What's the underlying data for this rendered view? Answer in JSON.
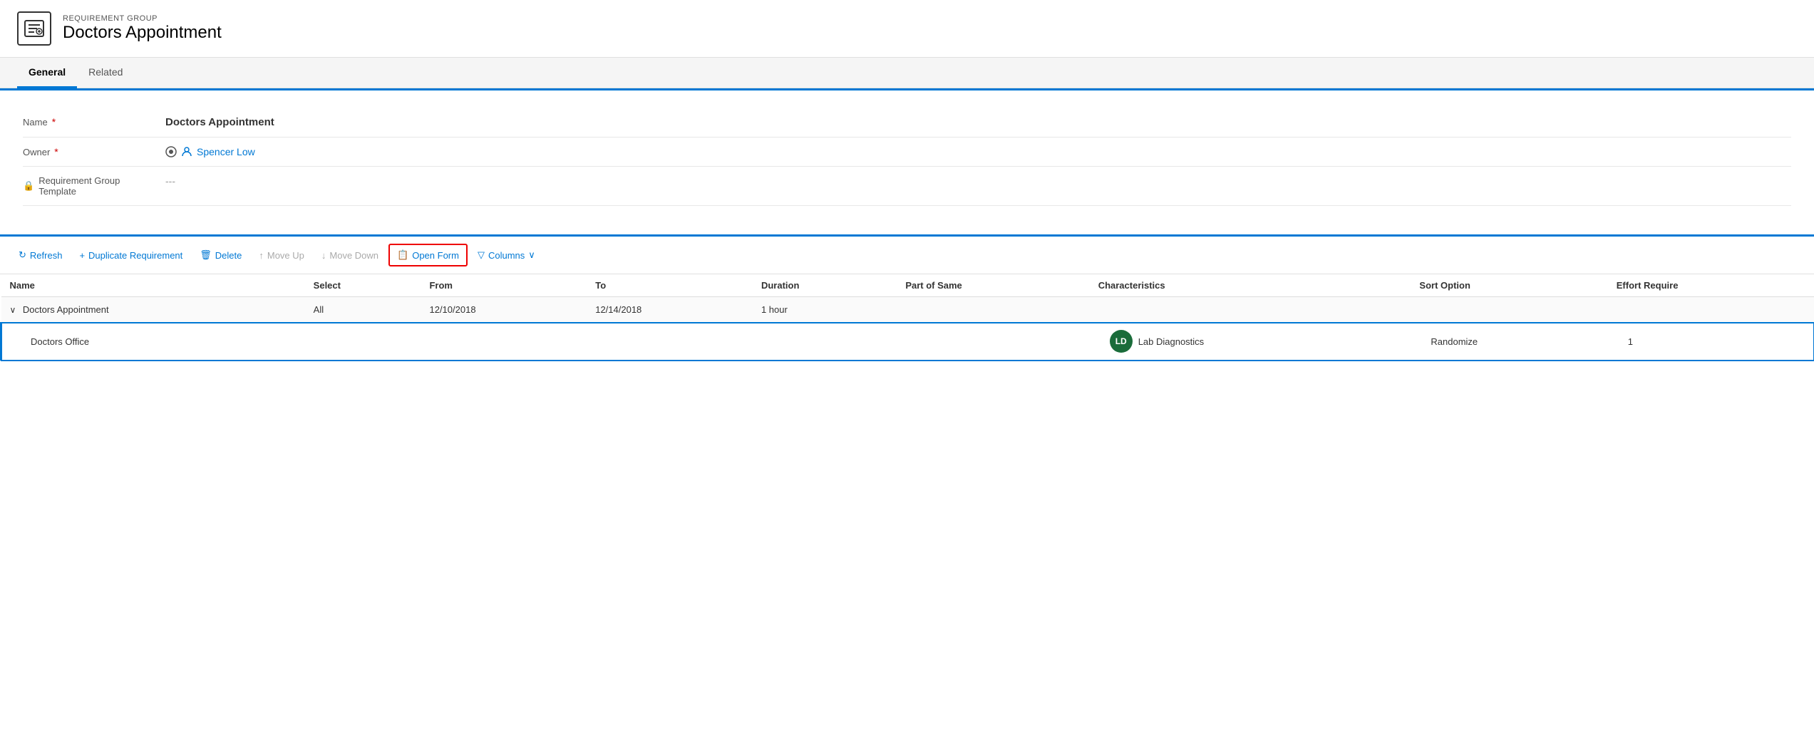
{
  "header": {
    "subtitle": "REQUIREMENT GROUP",
    "title": "Doctors Appointment"
  },
  "tabs": [
    {
      "label": "General",
      "active": true
    },
    {
      "label": "Related",
      "active": false
    }
  ],
  "form": {
    "fields": [
      {
        "label": "Name",
        "required": true,
        "value": "Doctors Appointment",
        "type": "bold"
      },
      {
        "label": "Owner",
        "required": true,
        "value": "Spencer Low",
        "type": "link"
      },
      {
        "label": "Requirement Group Template",
        "required": false,
        "value": "---",
        "type": "placeholder",
        "locked": true
      }
    ]
  },
  "toolbar": {
    "refresh_label": "Refresh",
    "duplicate_label": "Duplicate Requirement",
    "delete_label": "Delete",
    "move_up_label": "Move Up",
    "move_down_label": "Move Down",
    "open_form_label": "Open Form",
    "columns_label": "Columns"
  },
  "grid": {
    "columns": [
      {
        "label": "Name"
      },
      {
        "label": "Select"
      },
      {
        "label": "From"
      },
      {
        "label": "To"
      },
      {
        "label": "Duration"
      },
      {
        "label": "Part of Same"
      },
      {
        "label": "Characteristics"
      },
      {
        "label": "Sort Option"
      },
      {
        "label": "Effort Require"
      }
    ],
    "rows": [
      {
        "type": "group",
        "name": "Doctors Appointment",
        "select": "All",
        "from": "12/10/2018",
        "to": "12/14/2018",
        "duration": "1 hour",
        "part_of_same": "",
        "characteristics": "",
        "characteristics_badge": "",
        "characteristics_label": "",
        "sort_option": "",
        "effort_require": ""
      },
      {
        "type": "child",
        "name": "Doctors Office",
        "select": "",
        "from": "",
        "to": "",
        "duration": "",
        "part_of_same": "",
        "characteristics_badge": "LD",
        "characteristics_label": "Lab Diagnostics",
        "sort_option": "Randomize",
        "effort_require": "1",
        "selected": true
      }
    ]
  }
}
